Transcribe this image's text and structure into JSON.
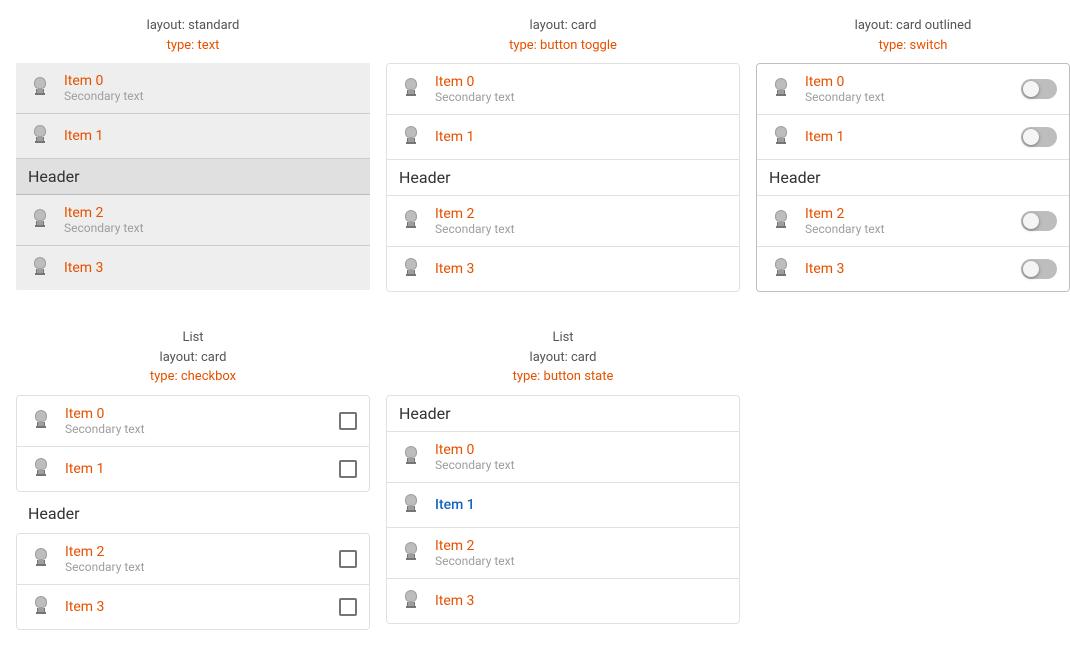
{
  "sections": [
    {
      "id": "standard-text",
      "title_lines": [
        "layout: standard",
        "type: text"
      ],
      "list_type": "standard",
      "control_type": "none",
      "items": [
        {
          "id": "item0",
          "primary": "Item 0",
          "secondary": "Secondary text"
        },
        {
          "id": "item1",
          "primary": "Item 1",
          "secondary": null
        }
      ],
      "header": "Header",
      "items2": [
        {
          "id": "item2",
          "primary": "Item 2",
          "secondary": "Secondary text"
        },
        {
          "id": "item3",
          "primary": "Item 3",
          "secondary": null
        }
      ]
    },
    {
      "id": "card-button-toggle",
      "title_lines": [
        "layout: card",
        "type: button toggle"
      ],
      "list_type": "card",
      "control_type": "none",
      "items": [
        {
          "id": "item0",
          "primary": "Item 0",
          "secondary": "Secondary text"
        },
        {
          "id": "item1",
          "primary": "Item 1",
          "secondary": null
        }
      ],
      "header": "Header",
      "items2": [
        {
          "id": "item2",
          "primary": "Item 2",
          "secondary": "Secondary text"
        },
        {
          "id": "item3",
          "primary": "Item 3",
          "secondary": null
        }
      ]
    },
    {
      "id": "card-outlined-switch",
      "title_lines": [
        "layout: card outlined",
        "type: switch"
      ],
      "list_type": "card-outlined",
      "control_type": "switch",
      "items": [
        {
          "id": "item0",
          "primary": "Item 0",
          "secondary": "Secondary text"
        },
        {
          "id": "item1",
          "primary": "Item 1",
          "secondary": null
        }
      ],
      "header": "Header",
      "items2": [
        {
          "id": "item2",
          "primary": "Item 2",
          "secondary": "Secondary text"
        },
        {
          "id": "item3",
          "primary": "Item 3",
          "secondary": null
        }
      ]
    }
  ],
  "sections_bottom": [
    {
      "id": "list-card-checkbox",
      "title_lines": [
        "List",
        "layout: card",
        "type: checkbox"
      ],
      "list_type": "card",
      "control_type": "checkbox",
      "header": "Header",
      "items": [
        {
          "id": "item0",
          "primary": "Item 0",
          "secondary": "Secondary text"
        },
        {
          "id": "item1",
          "primary": "Item 1",
          "secondary": null
        }
      ],
      "items2": [
        {
          "id": "item2",
          "primary": "Item 2",
          "secondary": "Secondary text"
        },
        {
          "id": "item3",
          "primary": "Item 3",
          "secondary": null
        }
      ]
    },
    {
      "id": "list-card-button-state",
      "title_lines": [
        "List",
        "layout: card",
        "type: button state"
      ],
      "list_type": "card",
      "control_type": "none",
      "header": "Header",
      "items": [
        {
          "id": "item0",
          "primary": "Item 0",
          "secondary": "Secondary text"
        },
        {
          "id": "item1",
          "primary": "Item 1",
          "secondary": null,
          "highlighted": true
        },
        {
          "id": "item2",
          "primary": "Item 2",
          "secondary": "Secondary text"
        },
        {
          "id": "item3",
          "primary": "Item 3",
          "secondary": null
        }
      ],
      "items2": []
    },
    {
      "id": "empty",
      "title_lines": [],
      "list_type": "none",
      "control_type": "none",
      "header": "",
      "items": [],
      "items2": []
    }
  ],
  "labels": {
    "header": "Header",
    "item_prefix": "Item",
    "secondary": "Secondary text"
  }
}
